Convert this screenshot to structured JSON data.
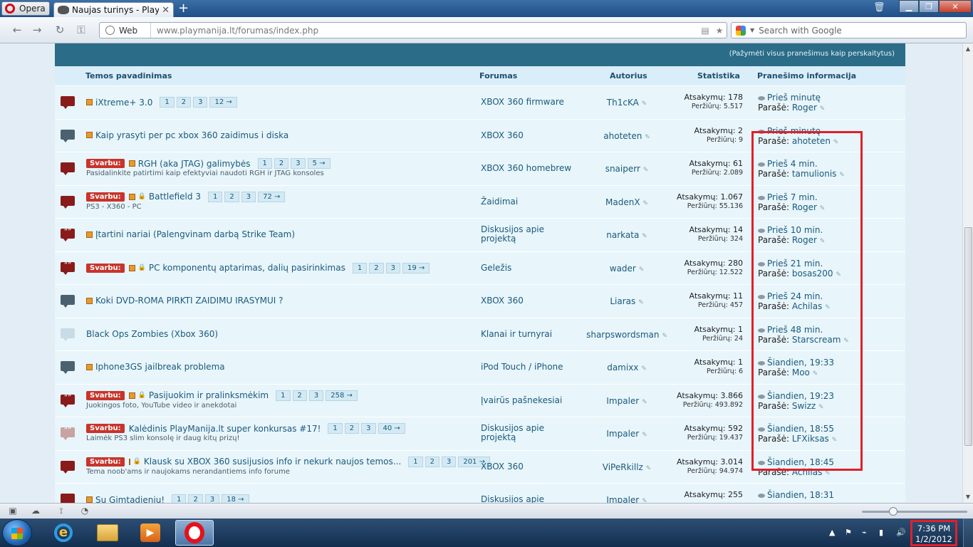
{
  "browser": {
    "menu_label": "Opera",
    "tab_title": "Naujas turinys - PlayM...",
    "tab_close": "✕",
    "new_tab": "+",
    "address_prefix": "Web",
    "url_host": "www.playmanija.lt",
    "url_path": "/forumas/index.php",
    "search_placeholder": "Search with Google"
  },
  "forum": {
    "mark_read": "(Pažymėti visus pranešimus kaip perskaitytus)",
    "columns": {
      "topic": "Temos pavadinimas",
      "forum": "Forumas",
      "author": "Autorius",
      "stats": "Statistika",
      "info": "Pranešimo informacija"
    },
    "replies_label": "Atsakymų:",
    "views_label": "Peržiūrų:",
    "posted_by_label": "Parašė:",
    "important_label": "Svarbu:",
    "rows": [
      {
        "icon": "red",
        "important": false,
        "poll": false,
        "title": "iXtreme+ 3.0",
        "desc": "",
        "pages": [
          "1",
          "2",
          "3",
          "12 →"
        ],
        "forum": "XBOX 360 firmware",
        "author": "Th1cKA",
        "replies": "178",
        "views": "5.517",
        "time": "Prieš minutę",
        "by": "Roger"
      },
      {
        "icon": "gray",
        "important": false,
        "poll": false,
        "title": "Kaip yrasyti per pc xbox 360 zaidimus i diska",
        "desc": "",
        "pages": [],
        "forum": "XBOX 360",
        "author": "ahoteten",
        "replies": "2",
        "views": "9",
        "time": "Prieš minutę",
        "by": "ahoteten"
      },
      {
        "icon": "red",
        "important": true,
        "poll": false,
        "title": "RGH (aka JTAG) galimybės",
        "desc": "Pasidalinkite patirtimi kaip efektyviai naudoti RGH ir JTAG konsoles",
        "pages": [
          "1",
          "2",
          "3",
          "5 →"
        ],
        "forum": "XBOX 360 homebrew",
        "author": "snaiperr",
        "replies": "61",
        "views": "2.089",
        "time": "Prieš 4 min.",
        "by": "tamulionis"
      },
      {
        "icon": "red",
        "important": true,
        "poll": true,
        "title": "Battlefield 3",
        "desc": "PS3 - X360 - PC",
        "pages": [
          "1",
          "2",
          "3",
          "72 →"
        ],
        "forum": "Žaidimai",
        "author": "MadenX",
        "replies": "1.067",
        "views": "55.136",
        "time": "Prieš 7 min.",
        "by": "Roger"
      },
      {
        "icon": "quote",
        "important": false,
        "poll": false,
        "title": "Įtartini nariai (Palengvinam darbą Strike Team)",
        "desc": "",
        "pages": [],
        "forum": "Diskusijos apie projektą",
        "author": "narkata",
        "replies": "14",
        "views": "324",
        "time": "Prieš 10 min.",
        "by": "Roger"
      },
      {
        "icon": "quote",
        "important": true,
        "poll": true,
        "title": "PC komponentų aptarimas, dalių pasirinkimas",
        "desc": "",
        "pages": [
          "1",
          "2",
          "3",
          "19 →"
        ],
        "forum": "Geležis",
        "author": "wader",
        "replies": "280",
        "views": "12.522",
        "time": "Prieš 21 min.",
        "by": "bosas200"
      },
      {
        "icon": "gray",
        "important": false,
        "poll": false,
        "title": "Koki DVD-ROMA PIRKTI ZAIDIMU IRASYMUI ?",
        "desc": "",
        "pages": [],
        "forum": "XBOX 360",
        "author": "Liaras",
        "replies": "11",
        "views": "457",
        "time": "Prieš 24 min.",
        "by": "Achilas"
      },
      {
        "icon": "light",
        "important": false,
        "poll": false,
        "title": "Black Ops Zombies (Xbox 360)",
        "desc": "",
        "pages": [],
        "forum": "Klanai ir turnyrai",
        "author": "sharpswordsman",
        "replies": "1",
        "views": "24",
        "time": "Prieš 48 min.",
        "by": "Starscream"
      },
      {
        "icon": "gray",
        "important": false,
        "poll": false,
        "title": "Iphone3GS jailbreak problema",
        "desc": "",
        "pages": [],
        "forum": "iPod Touch / iPhone",
        "author": "damixx",
        "replies": "1",
        "views": "6",
        "time": "Šiandien, 19:33",
        "by": "Moo"
      },
      {
        "icon": "quote",
        "important": true,
        "poll": true,
        "title": "Pasijuokim ir pralinksmėkim",
        "desc": "Juokingos foto, YouTube video ir anekdotai",
        "pages": [
          "1",
          "2",
          "3",
          "258 →"
        ],
        "forum": "Įvairūs pašnekesiai",
        "author": "Impaler",
        "replies": "3.866",
        "views": "493.892",
        "time": "Šiandien, 19:23",
        "by": "Swizz"
      },
      {
        "icon": "quote-light",
        "important": true,
        "poll": false,
        "title": "Kalėdinis PlayManija.lt super konkursas #17!",
        "desc": "Laimėk PS3 slim konsolę ir daug kitų prizų!",
        "pages": [
          "1",
          "2",
          "3",
          "40 →"
        ],
        "forum": "Diskusijos apie projektą",
        "author": "Impaler",
        "replies": "592",
        "views": "19.437",
        "time": "Šiandien, 18:55",
        "by": "LFXiksas"
      },
      {
        "icon": "red",
        "important": true,
        "poll": true,
        "title": "Klausk su XBOX 360 susijusios info ir nekurk naujos temos...",
        "desc": "Tema noob'ams ir naujokams nerandantiems info forume",
        "pages": [
          "1",
          "2",
          "3",
          "201 →"
        ],
        "forum": "XBOX 360",
        "author": "ViPeRkillz",
        "replies": "3.014",
        "views": "94.974",
        "time": "Šiandien, 18:45",
        "by": "Achilas"
      },
      {
        "icon": "red",
        "important": false,
        "poll": false,
        "title": "Su Gimtadieniu!",
        "desc": "",
        "pages": [
          "1",
          "2",
          "3",
          "18 →"
        ],
        "forum": "Diskusijos apie",
        "author": "Impaler",
        "replies": "255",
        "views": "",
        "time": "Šiandien, 18:31",
        "by": ""
      }
    ]
  },
  "taskbar": {
    "time": "7:36 PM",
    "date": "1/2/2012"
  },
  "colors": {
    "accent": "#2b6c88",
    "link": "#1a5a7a",
    "important": "#c8342b",
    "highlight_box": "#e0202a"
  }
}
